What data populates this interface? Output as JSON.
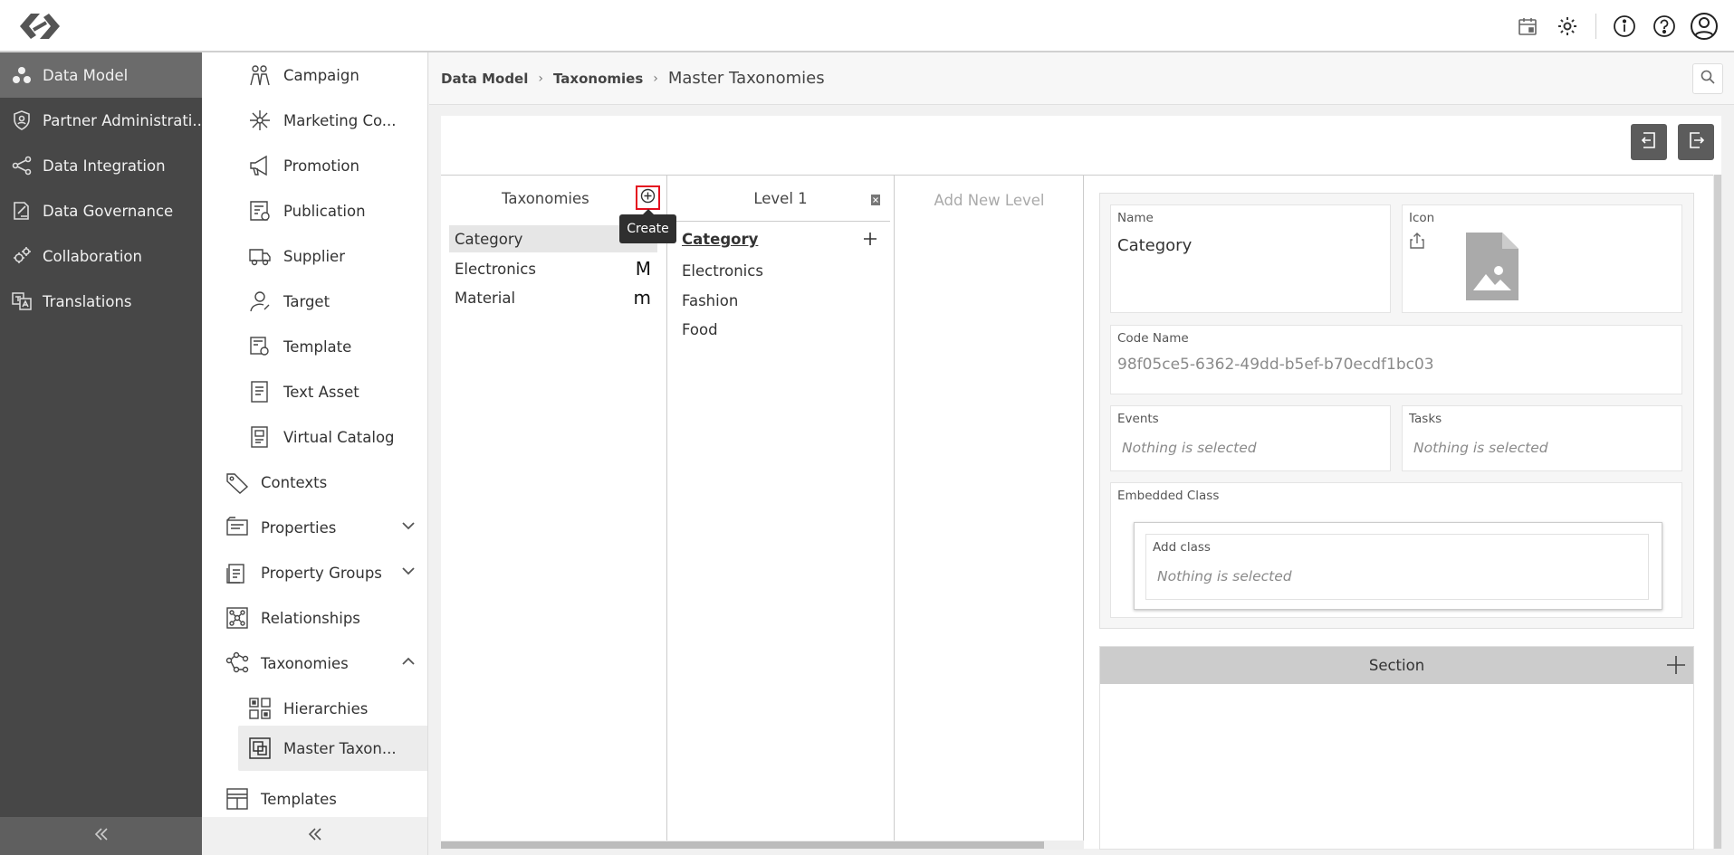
{
  "sidebar": {
    "items": [
      {
        "label": "Data Model",
        "icon": "data-model-icon",
        "active": true
      },
      {
        "label": "Partner Administrati...",
        "icon": "shield-icon"
      },
      {
        "label": "Data Integration",
        "icon": "share-nodes-icon"
      },
      {
        "label": "Data Governance",
        "icon": "governance-icon"
      },
      {
        "label": "Collaboration",
        "icon": "gears-icon"
      },
      {
        "label": "Translations",
        "icon": "translate-icon"
      }
    ]
  },
  "nav2": {
    "items": [
      {
        "label": "Campaign",
        "icon": "campaign-icon"
      },
      {
        "label": "Marketing Co...",
        "icon": "network-icon"
      },
      {
        "label": "Promotion",
        "icon": "megaphone-icon"
      },
      {
        "label": "Publication",
        "icon": "publication-icon"
      },
      {
        "label": "Supplier",
        "icon": "truck-icon"
      },
      {
        "label": "Target",
        "icon": "target-user-icon"
      },
      {
        "label": "Template",
        "icon": "template-icon"
      },
      {
        "label": "Text Asset",
        "icon": "text-asset-icon"
      },
      {
        "label": "Virtual Catalog",
        "icon": "catalog-icon"
      },
      {
        "label": "Contexts",
        "icon": "tag-icon"
      },
      {
        "label": "Properties",
        "icon": "properties-icon"
      },
      {
        "label": "Property Groups",
        "icon": "property-groups-icon"
      },
      {
        "label": "Relationships",
        "icon": "relationships-icon"
      },
      {
        "label": "Taxonomies",
        "icon": "taxonomies-icon"
      },
      {
        "label": "Hierarchies",
        "icon": "hierarchies-icon"
      },
      {
        "label": "Master Taxon...",
        "icon": "master-taxonomy-icon"
      },
      {
        "label": "Templates",
        "icon": "templates-icon"
      }
    ]
  },
  "breadcrumb": {
    "items": [
      "Data Model",
      "Taxonomies"
    ],
    "current": "Master Taxonomies",
    "separator": "›"
  },
  "taxonomies": {
    "header": "Taxonomies",
    "tooltip": "Create",
    "rows": [
      {
        "label": "Category",
        "marker": ""
      },
      {
        "label": "Electronics",
        "marker": "M"
      },
      {
        "label": "Material",
        "marker": "m"
      }
    ]
  },
  "level1": {
    "header": "Level 1",
    "title": "Category",
    "rows": [
      "Electronics",
      "Fashion",
      "Food"
    ]
  },
  "add_level": {
    "label": "Add New Level"
  },
  "detail": {
    "name_label": "Name",
    "name_value": "Category",
    "icon_label": "Icon",
    "code_label": "Code Name",
    "code_value": "98f05ce5-6362-49dd-b5ef-b70ecdf1bc03",
    "events_label": "Events",
    "events_value": "Nothing is selected",
    "tasks_label": "Tasks",
    "tasks_value": "Nothing is selected",
    "embedded_label": "Embedded Class",
    "add_class_label": "Add class",
    "add_class_value": "Nothing is selected",
    "section_label": "Section"
  },
  "colors": {
    "sidebar_bg": "#474747",
    "sidebar_active": "#6b6b6b",
    "highlight_red": "#e4101f",
    "button_dark": "#5c5c5c"
  }
}
